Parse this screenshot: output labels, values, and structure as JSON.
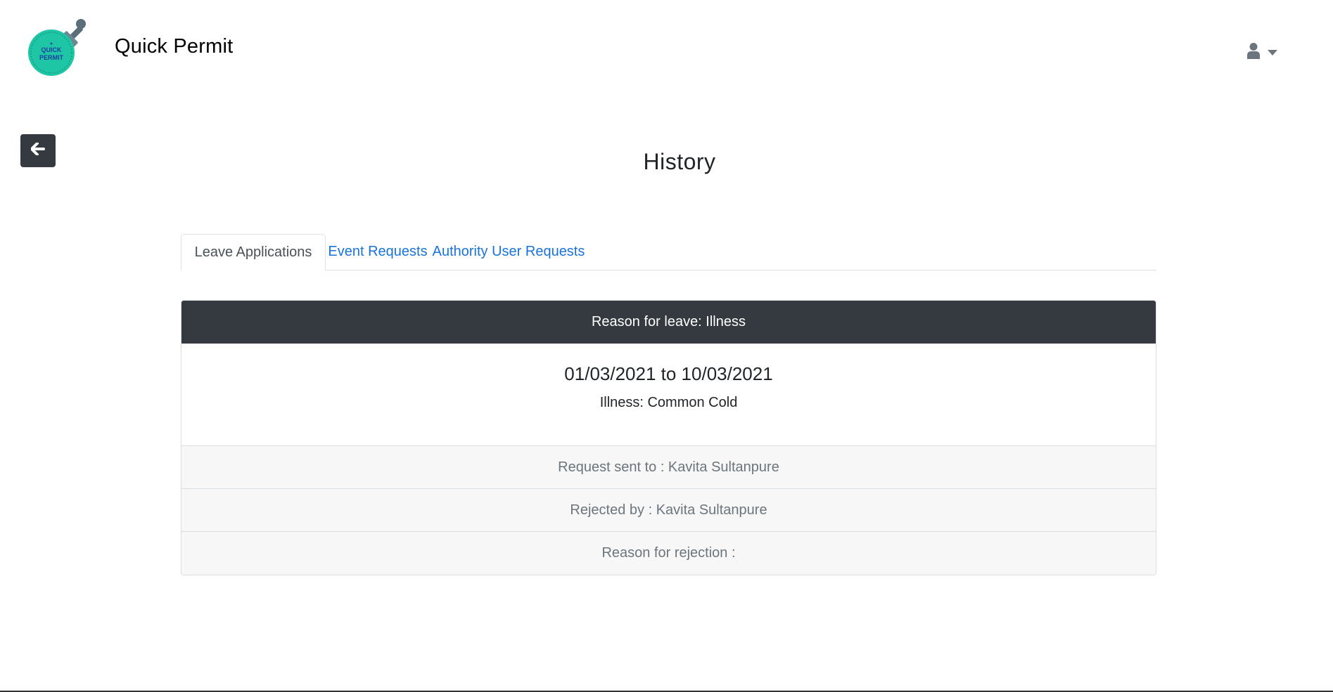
{
  "header": {
    "logo_text": "QUICK PERMIT",
    "app_title": "Quick Permit",
    "user_icon": "user-icon",
    "caret_icon": "caret-down-icon"
  },
  "back_button": {
    "icon": "arrow-left-icon"
  },
  "page": {
    "title": "History"
  },
  "tabs": [
    {
      "label": "Leave Applications",
      "active": true
    },
    {
      "label": "Event Requests",
      "active": false
    },
    {
      "label": "Authority User Requests",
      "active": false
    }
  ],
  "card": {
    "header": "Reason for leave: Illness",
    "dates": "01/03/2021 to 10/03/2021",
    "detail": "Illness: Common Cold",
    "rows": [
      "Request sent to : Kavita Sultanpure",
      "Rejected by : Kavita Sultanpure",
      "Reason for rejection :"
    ]
  },
  "colors": {
    "dark": "#343a40",
    "link": "#1a73d9",
    "logo_teal": "#1ec6a6",
    "logo_text": "#1b3fa0"
  }
}
